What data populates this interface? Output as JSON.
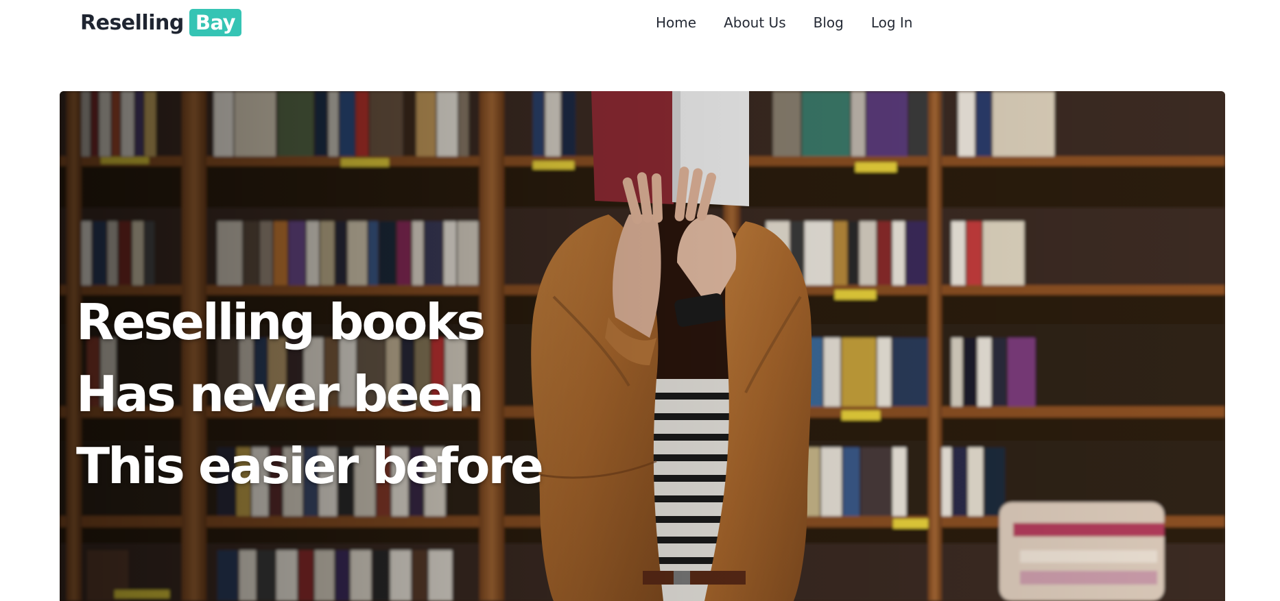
{
  "brand": {
    "name": "Reselling",
    "badge": "Bay",
    "accent_color": "#35c4b4"
  },
  "nav": {
    "items": [
      {
        "label": "Home"
      },
      {
        "label": "About Us"
      },
      {
        "label": "Blog"
      },
      {
        "label": "Log In"
      }
    ]
  },
  "hero": {
    "headline_lines": [
      "Reselling books",
      "Has never been",
      "This easier before"
    ],
    "image": "photo-person-hiding-face-behind-book-in-bookstore"
  }
}
